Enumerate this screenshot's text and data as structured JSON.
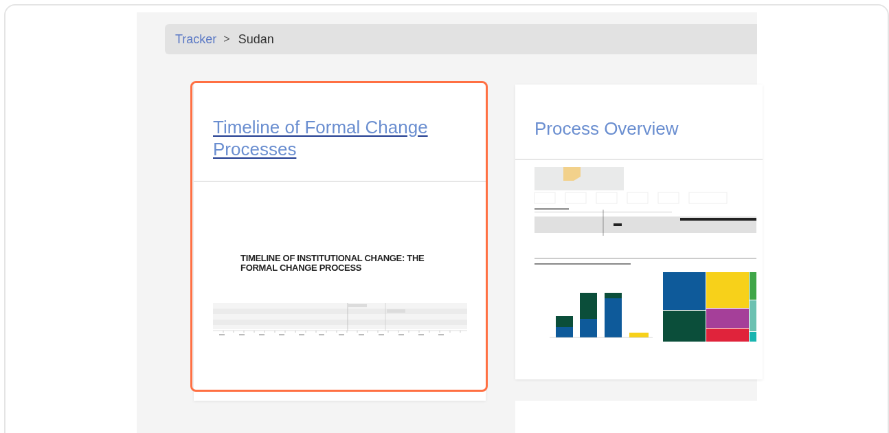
{
  "breadcrumb": {
    "separator": ">",
    "items": [
      {
        "label": "Tracker",
        "kind": "link"
      },
      {
        "label": "Sudan",
        "kind": "current"
      }
    ]
  },
  "cards": [
    {
      "title": "Timeline of Formal Change Processes",
      "highlighted": true,
      "kind": "timeline",
      "thumbnail_title": "TIMELINE OF INSTITUTIONAL CHANGE: THE FORMAL CHANGE PROCESS"
    },
    {
      "title": "Process Overview",
      "highlighted": false,
      "kind": "dashboard"
    }
  ]
}
